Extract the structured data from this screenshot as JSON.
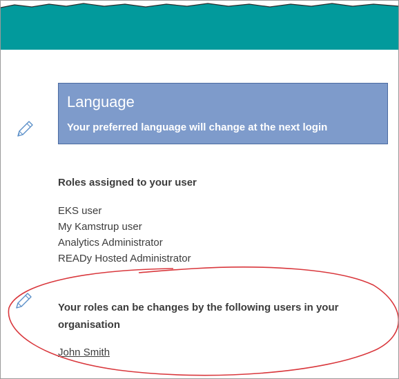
{
  "colors": {
    "banner": "#029a9c",
    "language_box": "#7e9bcb",
    "language_box_border": "#4a6aa0",
    "text": "#3c3c3c",
    "annotation": "#d9373c"
  },
  "language": {
    "title": "Language",
    "subtitle": "Your preferred language will change at the next login"
  },
  "icons": {
    "edit_language": "pencil-icon",
    "edit_roles": "pencil-icon"
  },
  "roles": {
    "heading": "Roles assigned to your user",
    "items": [
      "EKS user",
      "My Kamstrup user",
      "Analytics Administrator",
      "READy Hosted Administrator"
    ]
  },
  "role_managers": {
    "heading_line1": "Your roles can be changes by the following users in your",
    "heading_line2": "organisation",
    "users": [
      "John Smith"
    ]
  }
}
